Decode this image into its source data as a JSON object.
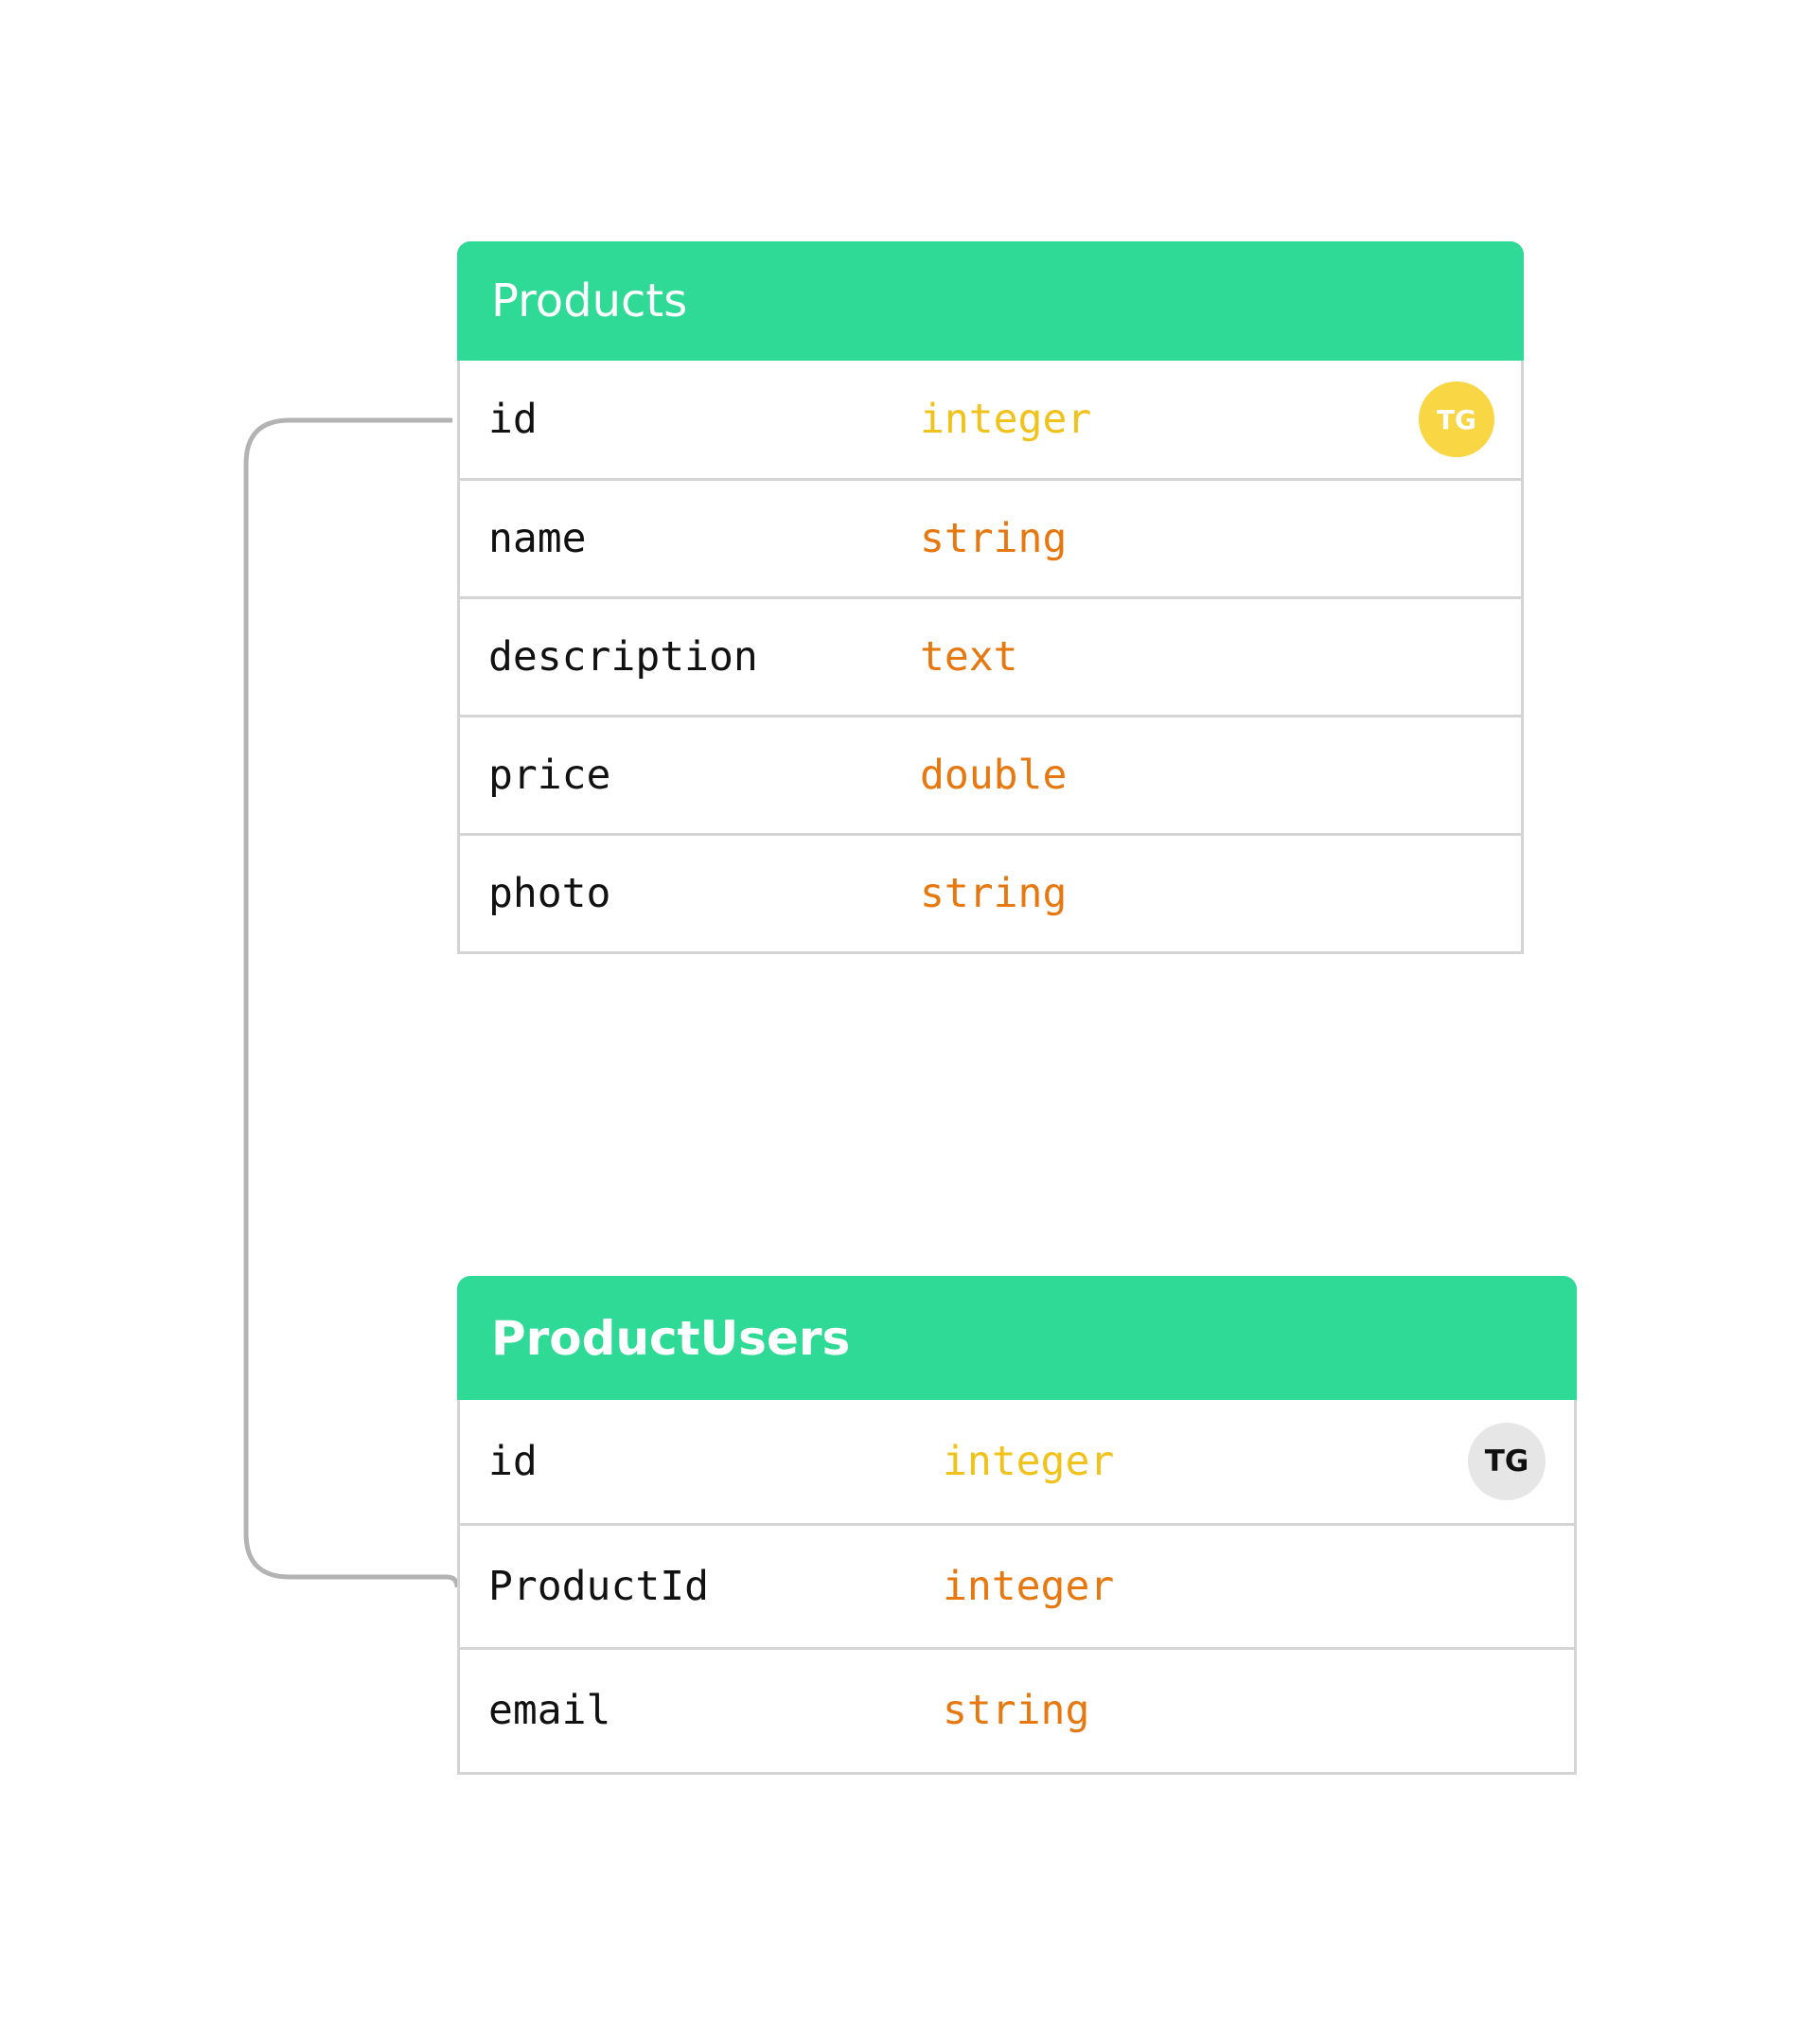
{
  "tables": [
    {
      "title": "Products",
      "fields": [
        {
          "name": "id",
          "type": "integer",
          "badge": "TG"
        },
        {
          "name": "name",
          "type": "string"
        },
        {
          "name": "description",
          "type": "text"
        },
        {
          "name": "price",
          "type": "double"
        },
        {
          "name": "photo",
          "type": "string"
        }
      ]
    },
    {
      "title": "ProductUsers",
      "fields": [
        {
          "name": "id",
          "type": "integer",
          "badge": "TG"
        },
        {
          "name": "ProductId",
          "type": "integer"
        },
        {
          "name": "email",
          "type": "string"
        }
      ]
    }
  ],
  "colors": {
    "header": "#2fd996",
    "primary_key_type": "#f0c21a",
    "type": "#e6780f",
    "border": "#d4d4d4",
    "connector": "#b3b3b3",
    "badge_products": "#f8d644",
    "badge_productusers": "#e6e6e6"
  }
}
